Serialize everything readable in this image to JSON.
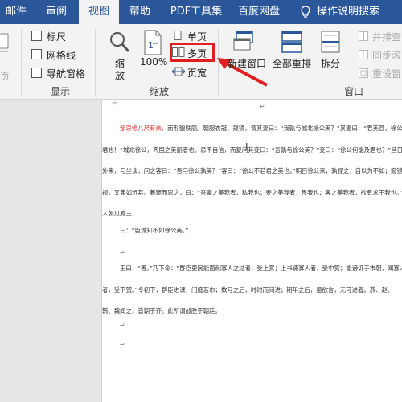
{
  "tabs": [
    {
      "label": "邮件",
      "active": false
    },
    {
      "label": "审阅",
      "active": false
    },
    {
      "label": "视图",
      "active": true
    },
    {
      "label": "帮助",
      "active": false
    },
    {
      "label": "PDF工具集",
      "active": false
    },
    {
      "label": "百度网盘",
      "active": false
    },
    {
      "label": "操作说明搜索",
      "active": false
    }
  ],
  "ribbon": {
    "partial_left_label": "页",
    "show_group": {
      "ruler": "标尺",
      "gridlines": "网格线",
      "nav_pane": "导航窗格",
      "label": "显示"
    },
    "zoom_group": {
      "zoom": "缩\n放",
      "zoom_line1": "缩",
      "zoom_line2": "放",
      "percent": "100%",
      "single_page": "单页",
      "multi_page": "多页",
      "page_width": "页宽",
      "label": "缩放"
    },
    "window_group": {
      "new_window": "新建窗口",
      "arrange_all": "全部重排",
      "split": "拆分",
      "side_by_side": "并排查",
      "sync_scroll": "同步滚",
      "reset_position": "重设窗",
      "label": "窗口"
    }
  },
  "colors": {
    "tab_bar": "#2b579a",
    "highlight": "#e02020",
    "arrow": "#e02020",
    "doc_red_text": "#d9302a"
  },
  "document": {
    "lines": [
      {
        "red": "邹忌修八尺有余，",
        "text": "而形貌昳丽。朝服衣冠，窥镜，谓其妻曰：“我孰与城北徐公美？”其妻曰：“君美甚，徐公何能及"
      },
      {
        "red": "",
        "text": "君也！”城北徐公，齐国之美丽者也。忌不自信，而复问其妾曰：“吾孰与徐公美？”妾曰：“徐公何能及君也？”旦日，客从"
      },
      {
        "red": "",
        "text": "外来，与坐谈，问之客曰：“吾与徐公孰美？”客曰：“徐公不若君之美也。”明日徐公来，孰视之，自以为不如；窥镜而自"
      },
      {
        "red": "",
        "text": "视，又弗如远甚。暮寝而思之，曰：“吾妻之美我者，私我也；妾之美我者，畏我也；客之美我者，欲有求于我也。”于是"
      },
      {
        "red": "",
        "text": "入朝见威王，"
      },
      {
        "red": "",
        "text": "曰：“臣诚知不如徐公美。”"
      },
      {
        "red": "",
        "text": "王曰：“善。”乃下令：“群臣吏民能面刺寡人之过者，受上赏；上书谏寡人者，受中赏；能谤讥于市朝，闻寡人之耳"
      },
      {
        "red": "",
        "text": "者，受下赏。”令初下，群臣进谏，门庭若市；数月之后，时时而间进；期年之后，虽欲言，无可进者。燕、赵、"
      },
      {
        "red": "",
        "text": "韩、魏闻之，皆朝于齐。此所谓战胜于朝廷。"
      }
    ]
  }
}
